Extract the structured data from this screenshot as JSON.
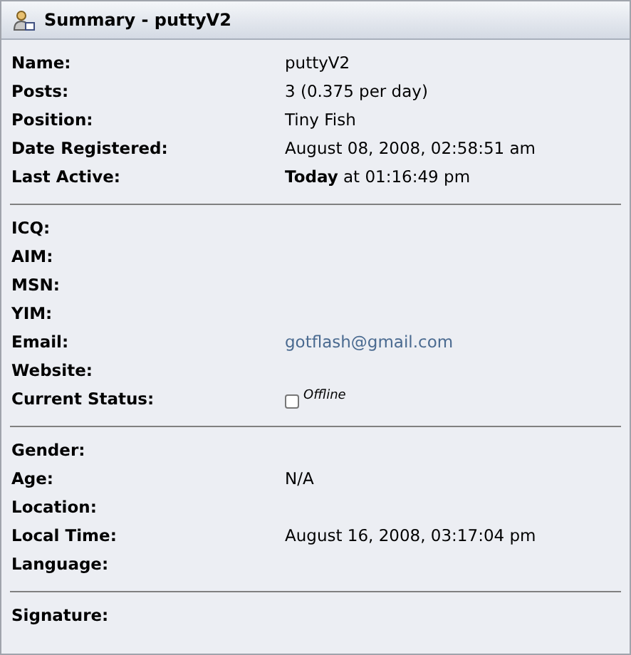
{
  "panel": {
    "title": "Summary - puttyV2"
  },
  "sections": [
    {
      "rows": [
        {
          "label": "Name:",
          "value": "puttyV2",
          "kind": "text"
        },
        {
          "label": "Posts:",
          "value": "3 (0.375 per day)",
          "kind": "text"
        },
        {
          "label": "Position:",
          "value": "Tiny Fish",
          "kind": "text"
        },
        {
          "label": "Date Registered:",
          "value": "August 08, 2008, 02:58:51 am",
          "kind": "text"
        },
        {
          "label": "Last Active:",
          "value": "**Today** at 01:16:49 pm",
          "kind": "text"
        }
      ]
    },
    {
      "rows": [
        {
          "label": "ICQ:"
        },
        {
          "label": "AIM:"
        },
        {
          "label": "MSN:"
        },
        {
          "label": "YIM:"
        },
        {
          "label": "Email:",
          "value": "gotflash@gmail.com",
          "kind": "link"
        },
        {
          "label": "Website:"
        },
        {
          "label": "Current Status:",
          "value": "Offline",
          "kind": "status",
          "checked": false
        }
      ]
    },
    {
      "rows": [
        {
          "label": "Gender:"
        },
        {
          "label": "Age:",
          "value": "N/A",
          "kind": "text"
        },
        {
          "label": "Location:"
        },
        {
          "label": "Local Time:",
          "value": "August 16, 2008, 03:17:04 pm",
          "kind": "text"
        },
        {
          "label": "Language:"
        }
      ]
    },
    {
      "rows": [
        {
          "label": "Signature:"
        }
      ]
    }
  ]
}
